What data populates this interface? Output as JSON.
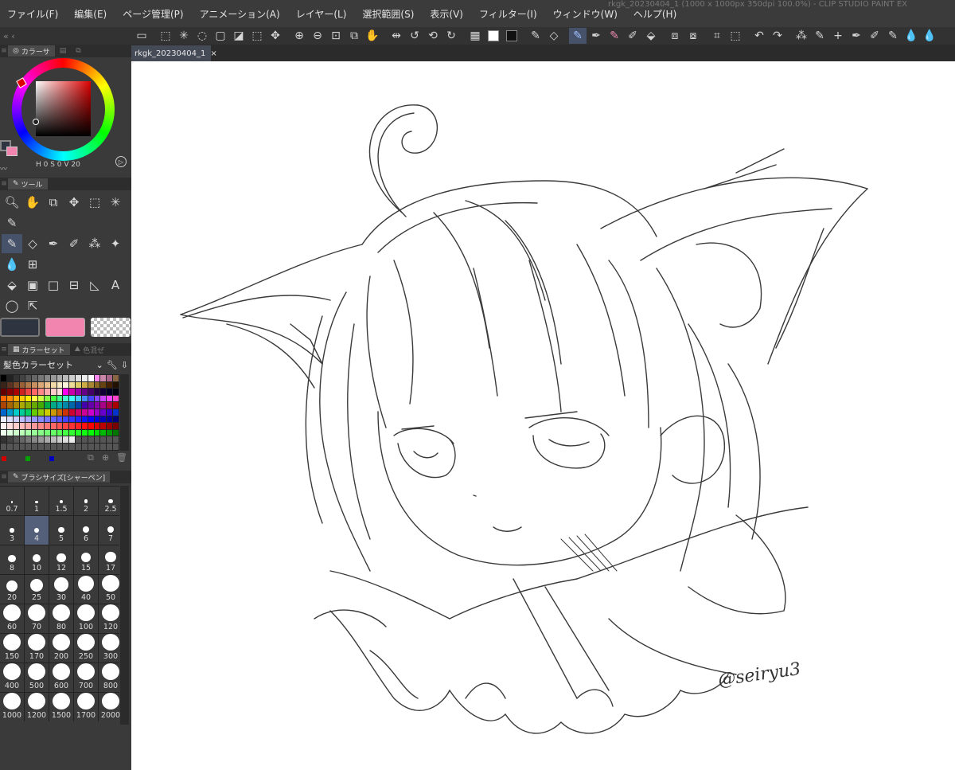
{
  "menu": [
    "ファイル(F)",
    "編集(E)",
    "ページ管理(P)",
    "アニメーション(A)",
    "レイヤー(L)",
    "選択範囲(S)",
    "表示(V)",
    "フィルター(I)",
    "ウィンドウ(W)",
    "ヘルプ(H)"
  ],
  "toolbar": {
    "left_glyphs": "« ‹",
    "icons": [
      {
        "name": "canvas-icon",
        "glyph": "▭"
      },
      {
        "name": "sep"
      },
      {
        "name": "select-all-icon",
        "glyph": "⬚"
      },
      {
        "name": "magic-wand-icon",
        "glyph": "✳"
      },
      {
        "name": "lasso-icon",
        "glyph": "◌"
      },
      {
        "name": "rect-select-icon",
        "glyph": "▢"
      },
      {
        "name": "fill-selection-icon",
        "glyph": "◪"
      },
      {
        "name": "clear-selection-icon",
        "glyph": "⬚"
      },
      {
        "name": "move-icon",
        "glyph": "✥"
      },
      {
        "name": "sep"
      },
      {
        "name": "zoom-in-icon",
        "glyph": "⊕"
      },
      {
        "name": "zoom-out-icon",
        "glyph": "⊖"
      },
      {
        "name": "zoom-fit-icon",
        "glyph": "⊡"
      },
      {
        "name": "fit-window-icon",
        "glyph": "⧉"
      },
      {
        "name": "hand-icon",
        "glyph": "✋"
      },
      {
        "name": "sep"
      },
      {
        "name": "flip-icon",
        "glyph": "⇹"
      },
      {
        "name": "rotate-left-icon",
        "glyph": "↺"
      },
      {
        "name": "rotate-reset-icon",
        "glyph": "⟲"
      },
      {
        "name": "rotate-right-icon",
        "glyph": "↻"
      },
      {
        "name": "sep"
      },
      {
        "name": "transparent-color-icon",
        "glyph": "▦"
      },
      {
        "name": "white-color-icon",
        "swatch": "#ffffff"
      },
      {
        "name": "black-color-icon",
        "swatch": "#111111"
      },
      {
        "name": "sep"
      },
      {
        "name": "eyedropper-icon",
        "glyph": "✎"
      },
      {
        "name": "eraser-icon",
        "glyph": "◇"
      },
      {
        "name": "sep"
      },
      {
        "name": "pencil-icon",
        "glyph": "✎",
        "active": true
      },
      {
        "name": "pen-icon",
        "glyph": "✒"
      },
      {
        "name": "pink-pen-icon",
        "glyph": "✎",
        "pink": true
      },
      {
        "name": "marker-icon",
        "glyph": "✐"
      },
      {
        "name": "fill-icon",
        "glyph": "⬙"
      },
      {
        "name": "sep"
      },
      {
        "name": "layer-icon",
        "glyph": "⧈"
      },
      {
        "name": "layer-2-icon",
        "glyph": "⧇"
      },
      {
        "name": "sep"
      },
      {
        "name": "crop-icon",
        "glyph": "⌗"
      },
      {
        "name": "transform-icon",
        "glyph": "⬚"
      },
      {
        "name": "sep"
      },
      {
        "name": "undo-icon",
        "glyph": "↶"
      },
      {
        "name": "redo-icon",
        "glyph": "↷"
      },
      {
        "name": "sep"
      },
      {
        "name": "spray-icon",
        "glyph": "⁂"
      },
      {
        "name": "brush-icon",
        "glyph": "✎"
      },
      {
        "name": "sparkle-icon",
        "glyph": "+"
      },
      {
        "name": "pen-2-icon",
        "glyph": "✒"
      },
      {
        "name": "brush-2-icon",
        "glyph": "✐"
      },
      {
        "name": "pen-3-icon",
        "glyph": "✎"
      },
      {
        "name": "blend-icon",
        "glyph": "💧"
      },
      {
        "name": "blend-2-icon",
        "glyph": "💧"
      }
    ]
  },
  "document_tab": {
    "title": "rkgk_20230404_1",
    "close": "×"
  },
  "title_ghost": "rkgk_20230404_1 (1000 x 1000px 350dpi 100.0%) - CLIP STUDIO PAINT EX",
  "color_panel": {
    "tab_label": "カラーサ",
    "info": "H 0 S 0 V 20",
    "main_color": "#2e3440",
    "sub_color": "#f285b0"
  },
  "tool_panel": {
    "tab_label": "ツール",
    "rows": [
      [
        {
          "name": "zoom-tool-icon",
          "glyph": "🔍︎"
        },
        {
          "name": "hand-tool-icon",
          "glyph": "✋"
        },
        {
          "name": "layer-move-tool-icon",
          "glyph": "⧉"
        },
        {
          "name": "move-tool-icon",
          "glyph": "✥"
        },
        {
          "name": "selection-tool-icon",
          "glyph": "⬚"
        },
        {
          "name": "magic-wand-tool-icon",
          "glyph": "✳"
        }
      ],
      [
        {
          "name": "eyedropper-tool-icon",
          "glyph": "✎"
        }
      ],
      [
        {
          "name": "pencil-tool-icon",
          "glyph": "✎",
          "active": true
        },
        {
          "name": "eraser-tool-icon",
          "glyph": "◇"
        },
        {
          "name": "pen-tool-icon",
          "glyph": "✒"
        },
        {
          "name": "marker-tool-icon",
          "glyph": "✐"
        },
        {
          "name": "airbrush-tool-icon",
          "glyph": "⁂"
        },
        {
          "name": "decoration-tool-icon",
          "glyph": "✦"
        }
      ],
      [
        {
          "name": "blend-tool-icon",
          "glyph": "💧"
        },
        {
          "name": "grid-tool-icon",
          "glyph": "⊞"
        }
      ],
      [
        {
          "name": "fill-tool-icon",
          "glyph": "⬙"
        },
        {
          "name": "gradient-tool-icon",
          "glyph": "▣"
        },
        {
          "name": "figure-tool-icon",
          "glyph": "□"
        },
        {
          "name": "frame-tool-icon",
          "glyph": "⊟"
        },
        {
          "name": "ruler-tool-icon",
          "glyph": "◺"
        },
        {
          "name": "text-tool-icon",
          "glyph": "A"
        }
      ],
      [
        {
          "name": "balloon-tool-icon",
          "glyph": "◯"
        },
        {
          "name": "correction-tool-icon",
          "glyph": "⇱"
        }
      ]
    ],
    "swatches": [
      "#2e3440",
      "#f285b0",
      "checker"
    ]
  },
  "color_set": {
    "tab_label": "カラーセット",
    "tab2_label": "色混ぜ",
    "selected": "髪色カラーセット",
    "footer_colors": [
      "#d00000",
      "#00a000",
      "#0000c0"
    ]
  },
  "brush_size": {
    "tab_label": "ブラシサイズ[シャーペン]",
    "sizes": [
      "0.7",
      "1",
      "1.5",
      "2",
      "2.5",
      "3",
      "4",
      "5",
      "6",
      "7",
      "8",
      "10",
      "12",
      "15",
      "17",
      "20",
      "25",
      "30",
      "40",
      "50",
      "60",
      "70",
      "80",
      "100",
      "120",
      "150",
      "170",
      "200",
      "250",
      "300",
      "400",
      "500",
      "600",
      "700",
      "800",
      "1000",
      "1200",
      "1500",
      "1700",
      "2000"
    ],
    "selected": "4"
  },
  "signature": "@seiryu3"
}
